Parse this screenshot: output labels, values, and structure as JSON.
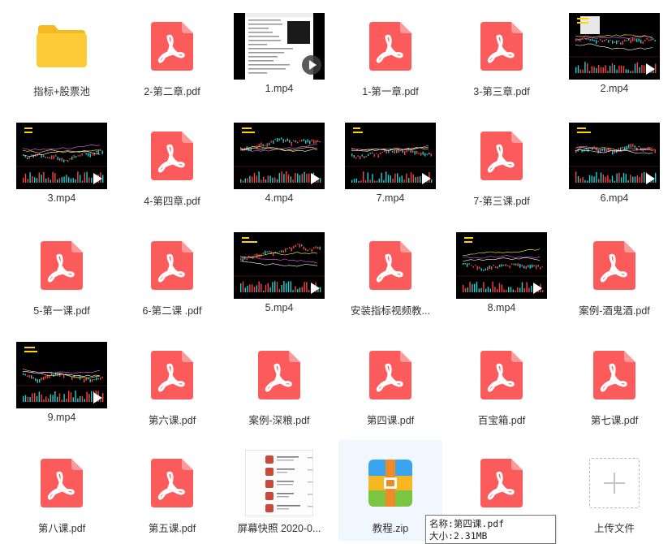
{
  "colors": {
    "pdf": "#fb5b5b",
    "pdf_fold": "#fc9999",
    "folder": "#fccb35",
    "folder_back": "#f5b921",
    "selected_bg": "#f1f7fe"
  },
  "items": [
    {
      "name": "指标+股票池",
      "type": "folder"
    },
    {
      "name": "2-第二章.pdf",
      "type": "pdf"
    },
    {
      "name": "1.mp4",
      "type": "video",
      "variant": "screen"
    },
    {
      "name": "1-第一章.pdf",
      "type": "pdf"
    },
    {
      "name": "3-第三章.pdf",
      "type": "pdf"
    },
    {
      "name": "2.mp4",
      "type": "video",
      "variant": "chart-a"
    },
    {
      "name": "3.mp4",
      "type": "video",
      "variant": "chart-b"
    },
    {
      "name": "4-第四章.pdf",
      "type": "pdf"
    },
    {
      "name": "4.mp4",
      "type": "video",
      "variant": "chart-c"
    },
    {
      "name": "7.mp4",
      "type": "video",
      "variant": "chart-d"
    },
    {
      "name": "7-第三课.pdf",
      "type": "pdf"
    },
    {
      "name": "6.mp4",
      "type": "video",
      "variant": "chart-e"
    },
    {
      "name": "5-第一课.pdf",
      "type": "pdf"
    },
    {
      "name": "6-第二课 .pdf",
      "type": "pdf"
    },
    {
      "name": "5.mp4",
      "type": "video",
      "variant": "chart-f"
    },
    {
      "name": "安装指标视频教...",
      "type": "pdf"
    },
    {
      "name": "8.mp4",
      "type": "video",
      "variant": "chart-g"
    },
    {
      "name": "案例-酒鬼酒.pdf",
      "type": "pdf"
    },
    {
      "name": "9.mp4",
      "type": "video",
      "variant": "chart-h"
    },
    {
      "name": "第六课.pdf",
      "type": "pdf"
    },
    {
      "name": "案例-深粮.pdf",
      "type": "pdf"
    },
    {
      "name": "第四课.pdf",
      "type": "pdf"
    },
    {
      "name": "百宝箱.pdf",
      "type": "pdf"
    },
    {
      "name": "第七课.pdf",
      "type": "pdf"
    },
    {
      "name": "第八课.pdf",
      "type": "pdf"
    },
    {
      "name": "第五课.pdf",
      "type": "pdf"
    },
    {
      "name": "屏幕快照 2020-0...",
      "type": "image"
    },
    {
      "name": "教程.zip",
      "type": "zip",
      "selected": true
    },
    {
      "name": "",
      "type": "pdf"
    },
    {
      "name": "上传文件",
      "type": "upload"
    }
  ],
  "tooltip": {
    "line1": "名称:第四课.pdf",
    "line2": "大小:2.31MB"
  }
}
